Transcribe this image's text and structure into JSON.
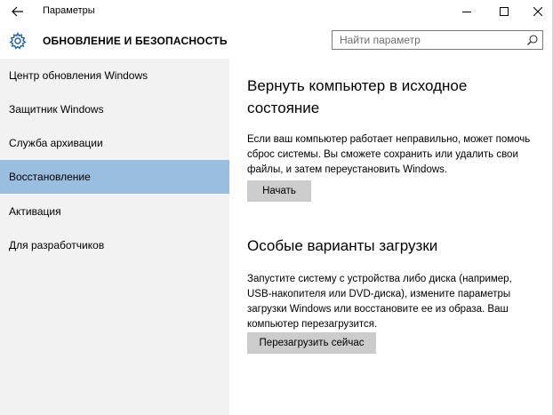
{
  "window": {
    "title": "Параметры"
  },
  "header": {
    "title": "ОБНОВЛЕНИЕ И БЕЗОПАСНОСТЬ",
    "search_placeholder": "Найти параметр"
  },
  "sidebar": {
    "items": [
      {
        "label": "Центр обновления Windows",
        "selected": false
      },
      {
        "label": "Защитник Windows",
        "selected": false
      },
      {
        "label": "Служба архивации",
        "selected": false
      },
      {
        "label": "Восстановление",
        "selected": true
      },
      {
        "label": "Активация",
        "selected": false
      },
      {
        "label": "Для разработчиков",
        "selected": false
      }
    ]
  },
  "main": {
    "reset": {
      "title": "Вернуть компьютер в исходное состояние",
      "description": "Если ваш компьютер работает неправильно, может помочь сброс системы. Вы сможете сохранить или удалить свои файлы, и затем переустановить Windows.",
      "button_label": "Начать"
    },
    "advanced": {
      "title": "Особые варианты загрузки",
      "description": "Запустите систему с устройства либо диска (например, USB-накопителя или DVD-диска), измените параметры загрузки Windows или восстановите ее из образа. Ваш компьютер перезагрузится.",
      "button_label": "Перезагрузить сейчас"
    }
  },
  "colors": {
    "selected_nav": "#99bedf",
    "sidebar_bg": "#f2f2f2",
    "button_bg": "#cccccc"
  }
}
